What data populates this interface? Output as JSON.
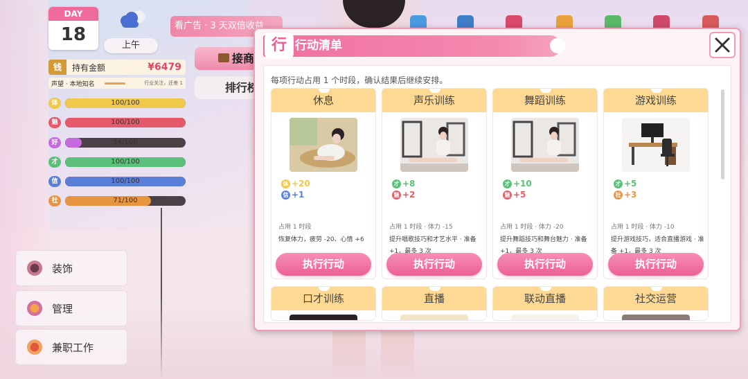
{
  "hud": {
    "day_label": "DAY",
    "day_number": "18",
    "time_of_day": "上午",
    "money_badge": "钱",
    "money_label": "持有金额",
    "money_value": "¥6479",
    "reputation_label": "声望 · 本地知名",
    "reputation_note": "行业关注，还差 1",
    "stats": [
      {
        "icon": "体",
        "value": "100/100",
        "level": 1.0,
        "color": "#f0c94a"
      },
      {
        "icon": "魅",
        "value": "100/100",
        "level": 1.0,
        "color": "#e45a6a"
      },
      {
        "icon": "好",
        "value": "14/100",
        "level": 0.14,
        "color": "#c86adf"
      },
      {
        "icon": "才",
        "value": "100/100",
        "level": 1.0,
        "color": "#5cc07a"
      },
      {
        "icon": "信",
        "value": "100/100",
        "level": 1.0,
        "color": "#5a7fd8"
      },
      {
        "icon": "社",
        "value": "71/100",
        "level": 0.71,
        "color": "#e89540"
      }
    ]
  },
  "side_menu": [
    {
      "label": "装饰",
      "icon": "decoration-icon"
    },
    {
      "label": "管理",
      "icon": "management-icon"
    },
    {
      "label": "兼职工作",
      "icon": "part-time-job-icon"
    }
  ],
  "background_ui": {
    "ad_banner": "看广告 · 3 天双倍收益",
    "button1": "接商",
    "button2": "排行榜"
  },
  "modal": {
    "badge": "行",
    "title": "行动清单",
    "intro": "每项行动占用 1 个时段，确认结果后继续安排。",
    "exec_label": "执行行动",
    "actions": [
      {
        "title": "休息",
        "effects": [
          {
            "icon": "体",
            "text": "+20",
            "color": "#f0c94a"
          },
          {
            "icon": "信",
            "text": "+1",
            "color": "#5a7fd8"
          }
        ],
        "meta": "占用 1 时段",
        "desc": "恢复体力，疲劳 -20、心情 +6",
        "image": "resting-woman-image"
      },
      {
        "title": "声乐训练",
        "effects": [
          {
            "icon": "才",
            "text": "+8",
            "color": "#5cc07a"
          },
          {
            "icon": "魅",
            "text": "+2",
            "color": "#e45a6a"
          }
        ],
        "meta": "占用 1 时段 · 体力 -15",
        "desc": "提升唱歌技巧和才艺水平 · 准备 +1，最多 3 次",
        "image": "gym-stretching-image"
      },
      {
        "title": "舞蹈训练",
        "effects": [
          {
            "icon": "才",
            "text": "+10",
            "color": "#5cc07a"
          },
          {
            "icon": "魅",
            "text": "+5",
            "color": "#e45a6a"
          }
        ],
        "meta": "占用 1 时段 · 体力 -20",
        "desc": "提升舞蹈技巧和舞台魅力 · 准备 +1，最多 3 次",
        "image": "gym-stretching-image"
      },
      {
        "title": "游戏训练",
        "effects": [
          {
            "icon": "才",
            "text": "+5",
            "color": "#5cc07a"
          },
          {
            "icon": "社",
            "text": "+3",
            "color": "#e89540"
          }
        ],
        "meta": "占用 1 时段 · 体力 -10",
        "desc": "提升游戏技巧，适合直播游戏 · 准备 +1，最多 3 次",
        "image": "gaming-desk-image"
      }
    ],
    "more_actions": [
      "口才训练",
      "直播",
      "联动直播",
      "社交运营"
    ]
  },
  "colors": {
    "accent_pink": "#ef6b9b",
    "card_header": "#fdd993",
    "money_red": "#e0456a"
  }
}
